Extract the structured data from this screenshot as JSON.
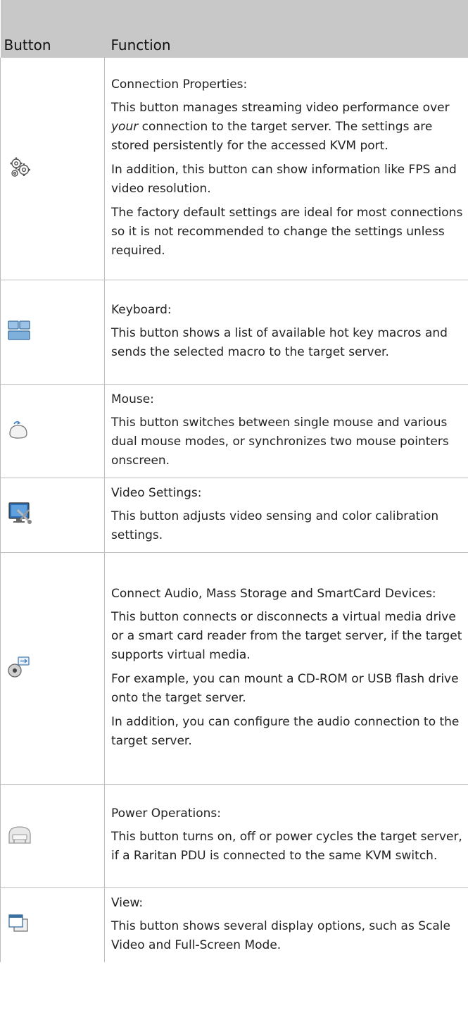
{
  "table": {
    "header": {
      "button": "Button",
      "function": "Function"
    },
    "rows": [
      {
        "icon": "gears-icon",
        "title": "Connection Properties:",
        "paragraphs": [
          {
            "before": "This button manages streaming video performance over ",
            "em": "your",
            "after": " connection to the target server. The settings are stored persistently for the accessed KVM port."
          },
          "In addition, this button can show information like FPS and video resolution.",
          "The factory default settings are ideal for most connections so it is not recommended to change the settings unless required."
        ]
      },
      {
        "icon": "keyboard-icon",
        "title": "Keyboard:",
        "paragraphs": [
          "This button shows a list of available hot key macros and sends the selected macro to the target server."
        ]
      },
      {
        "icon": "mouse-icon",
        "title": "Mouse:",
        "paragraphs": [
          "This button switches between single mouse and various dual mouse modes, or synchronizes two mouse pointers onscreen."
        ]
      },
      {
        "icon": "video-settings-icon",
        "title": "Video Settings:",
        "paragraphs": [
          "This button adjusts video sensing and color calibration settings."
        ]
      },
      {
        "icon": "virtual-media-icon",
        "title": "Connect Audio, Mass Storage and SmartCard Devices:",
        "paragraphs": [
          "This button connects or disconnects a virtual media drive or a smart card reader from the target server, if the target supports virtual media.",
          "For example, you can mount a CD-ROM or USB flash drive onto the target server.",
          "In addition, you can configure the audio connection to the target server."
        ]
      },
      {
        "icon": "power-icon",
        "title": "Power Operations:",
        "paragraphs": [
          "This button turns on, off or power cycles the target server, if a Raritan PDU is connected to the same KVM switch."
        ]
      },
      {
        "icon": "view-icon",
        "title": "View:",
        "paragraphs": [
          "This button shows several display options, such as Scale Video and Full-Screen Mode."
        ]
      }
    ]
  }
}
